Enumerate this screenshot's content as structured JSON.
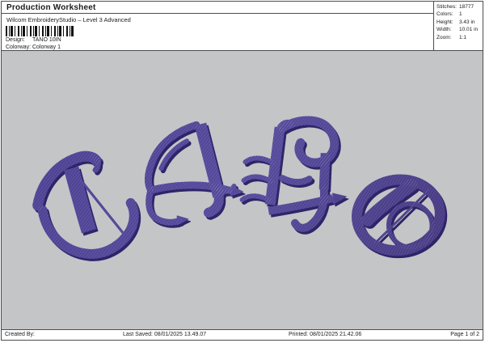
{
  "header": {
    "title": "Production Worksheet",
    "subtitle": "Wilcom EmbroideryStudio – Level 3 Advanced",
    "design": {
      "label": "Design:",
      "value": "TANO 10IN"
    },
    "colorway": {
      "label": "Colorway:",
      "value": "Colorway 1"
    }
  },
  "stats": {
    "rows": [
      {
        "label": "Stitches:",
        "value": "18777"
      },
      {
        "label": "Colors:",
        "value": "1"
      },
      {
        "label": "Height:",
        "value": "3.43 in"
      },
      {
        "label": "Width:",
        "value": "10.01 in"
      },
      {
        "label": "Zoom:",
        "value": "1:1"
      }
    ]
  },
  "design_canvas": {
    "text": "TANO",
    "letters": [
      "T",
      "A",
      "N",
      "O"
    ],
    "style": "Old English blackletter embroidery, arched baseline",
    "thread_color": "#46398a",
    "thread_shadow_color": "#2e2468",
    "background_color": "#c4c5c7"
  },
  "footer": {
    "created_by": "Created By:",
    "last_saved": "Last Saved: 08/01/2025 13.49.07",
    "printed": "Printed: 08/01/2025 21.42.06",
    "page": "Page 1 of 2"
  }
}
